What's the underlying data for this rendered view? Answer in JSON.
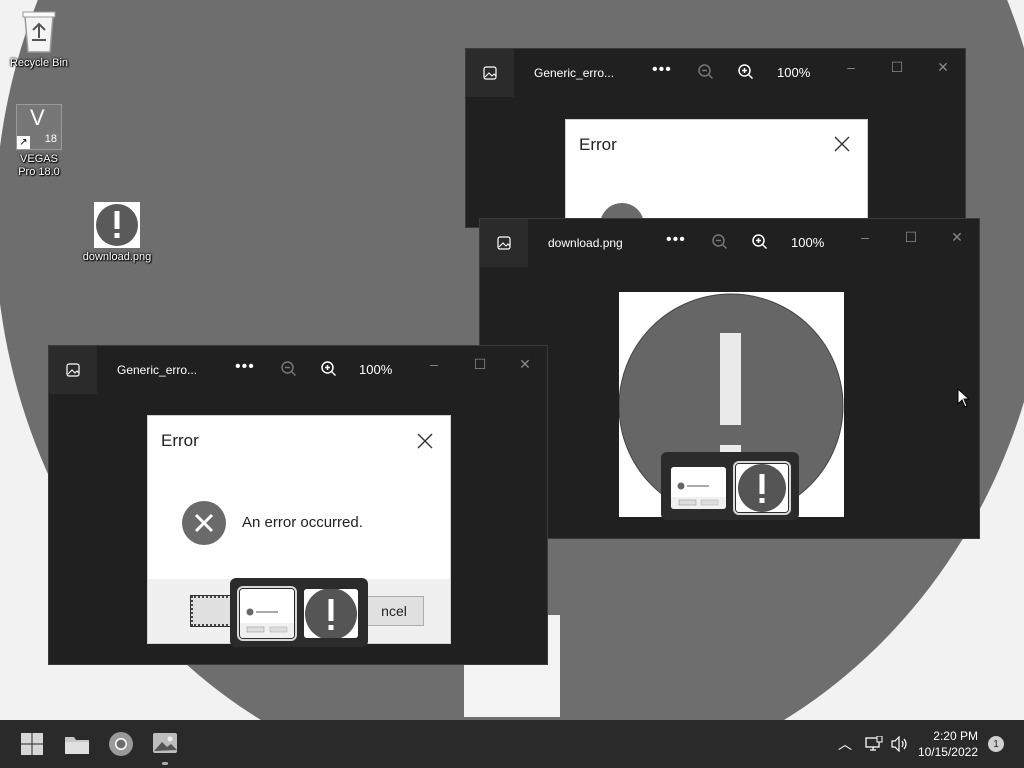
{
  "desktop": {
    "icons": [
      {
        "label": "Recycle Bin"
      },
      {
        "label": "VEGAS Pro 18.0",
        "badge": "V",
        "version": "18"
      },
      {
        "label": "download.png"
      }
    ]
  },
  "windows": [
    {
      "title": "Generic_erro...",
      "zoom": "100%",
      "dialog": {
        "title": "Error"
      }
    },
    {
      "title": "download.png",
      "zoom": "100%"
    },
    {
      "title": "Generic_erro...",
      "zoom": "100%",
      "dialog": {
        "title": "Error",
        "message": "An error occurred.",
        "cancel_partial": "ncel"
      },
      "thumb_dialog": {
        "message": "An error occurred.",
        "ok": "OK",
        "cancel": "Cancel"
      }
    }
  ],
  "taskbar": {
    "apps": [
      "start-icon",
      "file-explorer-icon",
      "chrome-icon",
      "photos-icon"
    ],
    "time": "2:20 PM",
    "date": "10/15/2022",
    "notifications": "1"
  },
  "colors": {
    "wallpaper_circle": "#6e6e6e",
    "window_bg": "#202020",
    "taskbar_bg": "#2a2a2a",
    "error_icon": "#6a6a6a"
  }
}
